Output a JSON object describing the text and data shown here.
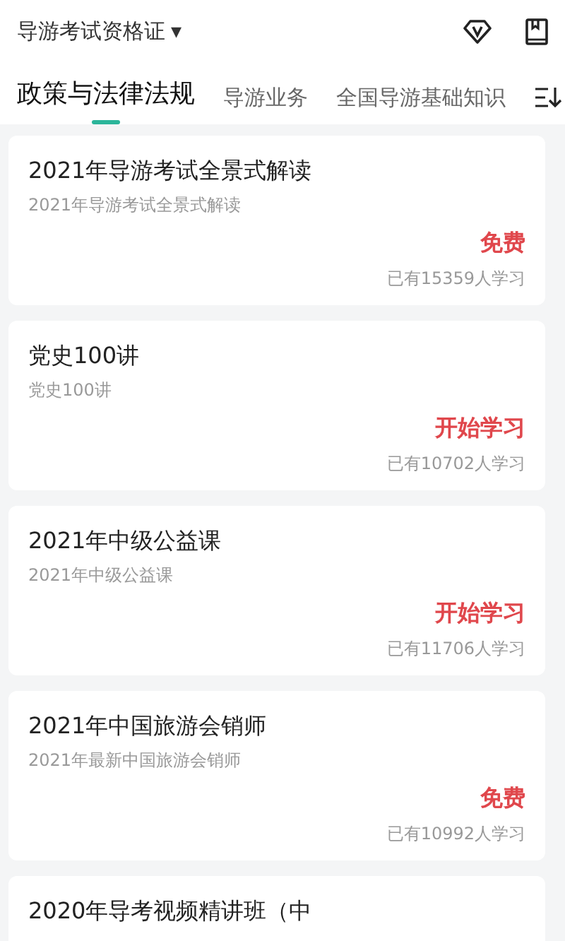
{
  "header": {
    "title": "导游考试资格证",
    "dropdown_icon": "▾"
  },
  "tabs": [
    {
      "label": "政策与法律法规",
      "selected": true
    },
    {
      "label": "导游业务",
      "selected": false
    },
    {
      "label": "全国导游基础知识",
      "selected": false
    }
  ],
  "courses": [
    {
      "title": "2021年导游考试全景式解读",
      "subtitle": "2021年导游考试全景式解读",
      "price": "免费",
      "learners": "已有15359人学习"
    },
    {
      "title": "党史100讲",
      "subtitle": "党史100讲",
      "price": "开始学习",
      "learners": "已有10702人学习"
    },
    {
      "title": "2021年中级公益课",
      "subtitle": "2021年中级公益课",
      "price": "开始学习",
      "learners": "已有11706人学习"
    },
    {
      "title": "2021年中国旅游会销师",
      "subtitle": "2021年最新中国旅游会销师",
      "price": "免费",
      "learners": "已有10992人学习"
    },
    {
      "title": "2020年导考视频精讲班（中"
    }
  ]
}
